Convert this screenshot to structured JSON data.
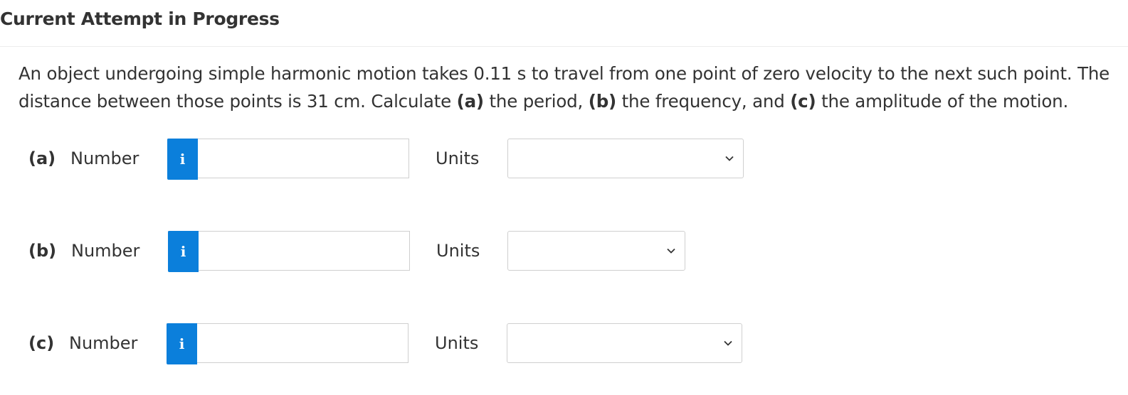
{
  "header": {
    "title": "Current Attempt in Progress"
  },
  "question": {
    "intro": "An object undergoing simple harmonic motion takes 0.11 s to travel from one point of zero velocity to the next such point. The distance between those points is 31 cm. Calculate ",
    "part_a": "(a)",
    "text_a": " the period, ",
    "part_b": "(b)",
    "text_b": " the frequency, and ",
    "part_c": "(c)",
    "text_c": " the amplitude of the motion."
  },
  "parts": [
    {
      "label": "(a)",
      "number_label": "Number",
      "info_icon": "i",
      "value": "",
      "units_label": "Units",
      "units_selected": ""
    },
    {
      "label": "(b)",
      "number_label": "Number",
      "info_icon": "i",
      "value": "",
      "units_label": "Units",
      "units_selected": ""
    },
    {
      "label": "(c)",
      "number_label": "Number",
      "info_icon": "i",
      "value": "",
      "units_label": "Units",
      "units_selected": ""
    }
  ],
  "colors": {
    "info_button": "#0b7fdb",
    "text": "#333333",
    "border": "#cfcfcf"
  }
}
